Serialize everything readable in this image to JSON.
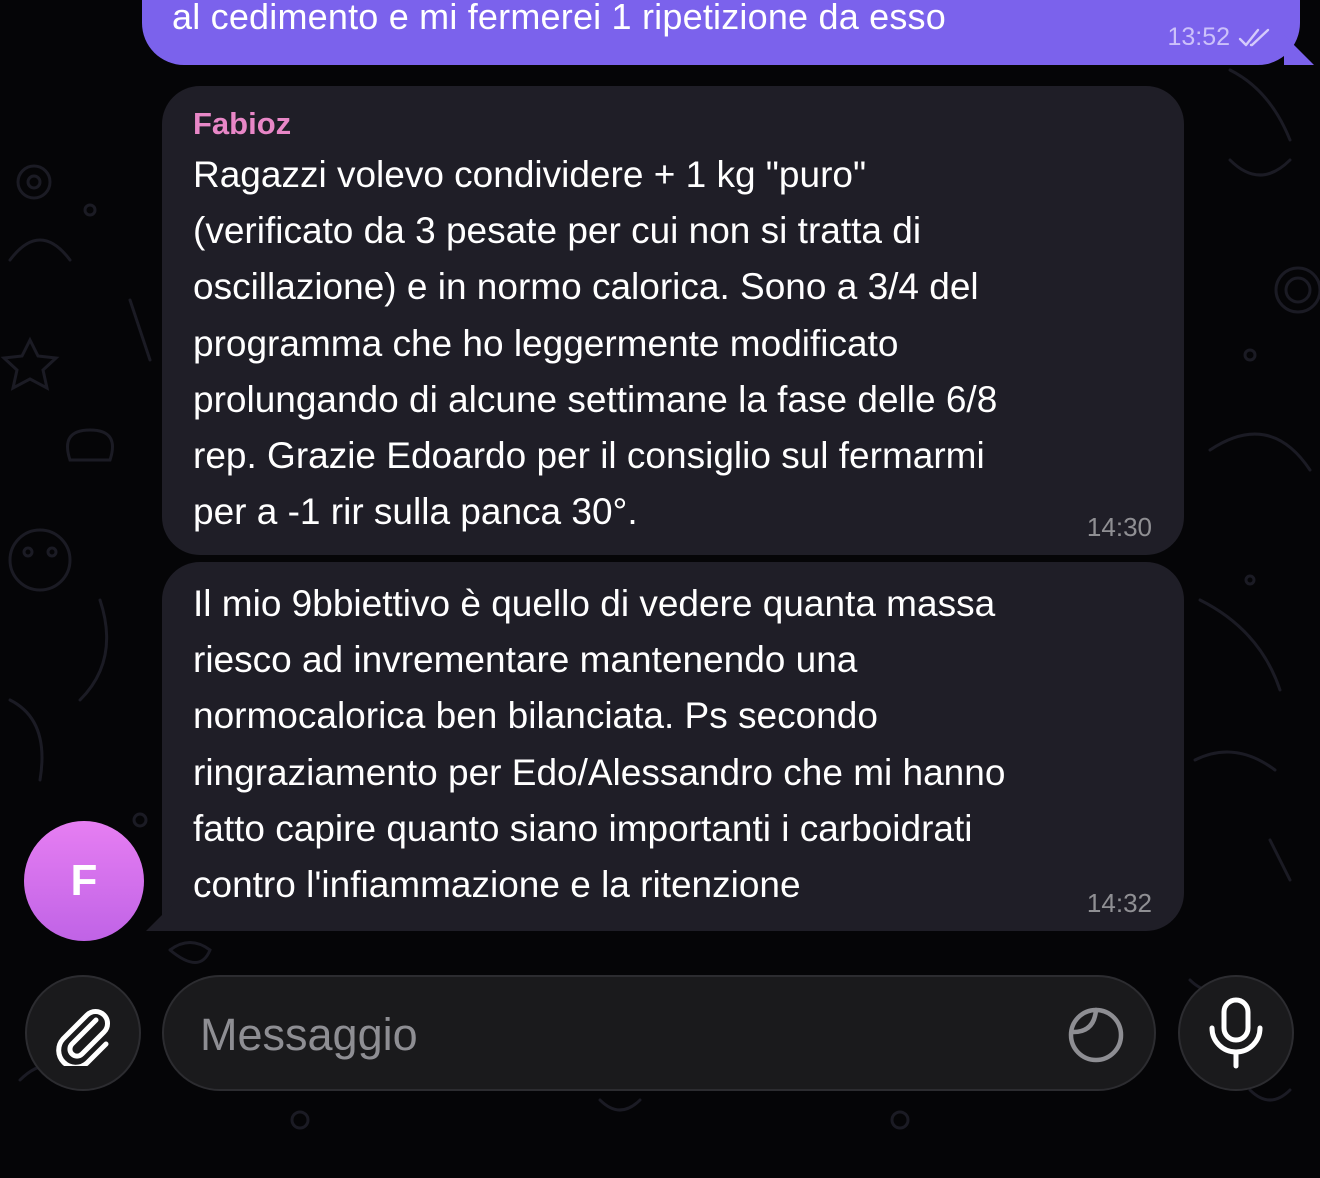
{
  "chat": {
    "outgoing_partial": {
      "text": "al cedimento e mi fermerei 1 ripetizione da esso",
      "time": "13:52",
      "status_icon": "double-check-icon"
    },
    "messages": [
      {
        "sender": "Fabioz",
        "text": "Ragazzi volevo condividere + 1 kg \"puro\"\n(verificato da 3 pesate per cui non si tratta di\noscillazione) e in normo calorica. Sono a 3/4 del\nprogramma che ho leggermente modificato\nprolungando di alcune settimane la fase delle 6/8\nrep. Grazie Edoardo per il consiglio sul fermarmi\nper a -1 rir sulla panca 30°.",
        "time": "14:30"
      },
      {
        "text": "Il mio 9bbiettivo è quello di vedere quanta massa\nriesco ad invrementare mantenendo una\nnormocalorica ben bilanciata. Ps secondo\nringraziamento per Edo/Alessandro che mi hanno\nfatto capire quanto siano importanti i carboidrati\ncontro l'infiammazione e la ritenzione",
        "time": "14:32"
      }
    ],
    "avatar": {
      "initial": "F",
      "color": "#d874ee"
    }
  },
  "composer": {
    "placeholder": "Messaggio",
    "attach_icon": "paperclip-icon",
    "sticker_icon": "sticker-icon",
    "mic_icon": "microphone-icon"
  },
  "colors": {
    "outgoing_bubble": "#7b62ec",
    "incoming_bubble": "#1f1e27",
    "sender_name": "#e887c7",
    "background": "#050507"
  }
}
